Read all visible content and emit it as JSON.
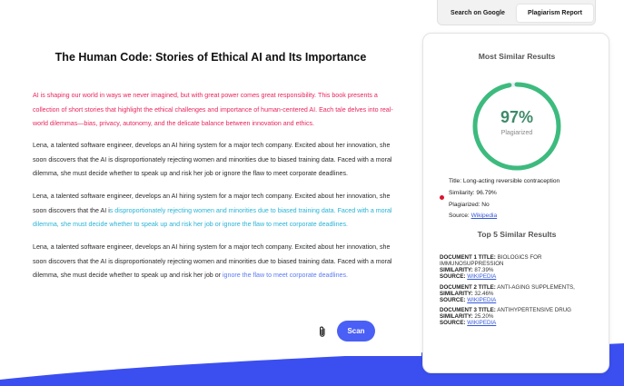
{
  "editor": {
    "title": "The Human Code: Stories of Ethical AI and Its Importance",
    "intro": "AI is shaping our world in ways we never imagined, but with great power comes great responsibility. This book presents a collection of short stories that highlight the ethical challenges and importance of human-centered AI. Each tale delves into real-world dilemmas—bias, privacy, autonomy, and the delicate balance between innovation and ethics.",
    "para1": "Lena, a talented software engineer, develops an AI hiring system for a major tech company. Excited about her innovation, she soon discovers that the AI is disproportionately rejecting women and minorities due to biased training data. Faced with a moral dilemma, she must decide whether to speak up and risk her job or ignore the flaw to meet corporate deadlines.",
    "para2_plain": "Lena, a talented software engineer, develops an AI hiring system for a major tech company. Excited about her innovation, she soon discovers that the AI i",
    "para2_highlight": "s disproportionately rejecting women and minorities due to biased training data. Faced with a moral dilemma, she must decide whether to speak up and risk her job or ignore the flaw to meet corporate deadlines.",
    "para3_plain": "Lena, a talented software engineer, develops an AI hiring system for a major tech company. Excited about her innovation, she soon discovers that the AI is disproportionately rejecting women and minorities due to biased training data. Faced with a moral dilemma, she must decide whether to speak up and risk her job or ",
    "para3_highlight": "ignore the flaw to meet corporate deadlines.",
    "scan_label": "Scan",
    "attach_icon": "paperclip-icon"
  },
  "tabs": [
    {
      "label": "Search on Google",
      "active": false
    },
    {
      "label": "Plagiarism Report",
      "active": true
    }
  ],
  "report": {
    "heading": "Most  Similar Results",
    "percent": "97%",
    "percent_value": 0.97,
    "percent_caption": "Plagiarized",
    "title_line": "Title: Long-acting reversible contraception",
    "similarity_line": "Similarity: 96.79%",
    "plagiarized_line": "Plagiarized: No",
    "source_label": "Source: ",
    "source_link": "Wikipedia",
    "top5_heading": "Top 5 Similar Results",
    "documents": [
      {
        "title_label": "DOCUMENT 1 TITLE:",
        "title": "BIOLOGICS FOR IMMUNOSUPPRESSION",
        "similarity_label": "SIMILARITY:",
        "similarity": "87.39%",
        "source_label": "SOURCE:",
        "source": "WIKIPEDIA"
      },
      {
        "title_label": "DOCUMENT 2 TITLE:",
        "title": "ANTI-AGING SUPPLEMENTS,",
        "similarity_label": "SIMILARITY:",
        "similarity": "32.46%",
        "source_label": "SOURCE:",
        "source": "WIKIPEDIA"
      },
      {
        "title_label": "DOCUMENT 3 TITLE:",
        "title": "ANTIHYPERTENSIVE DRUG",
        "similarity_label": "SIMILARITY:",
        "similarity": "25.20%",
        "source_label": "SOURCE:",
        "source": "WIKIPEDIA"
      }
    ]
  },
  "colors": {
    "accent": "#4a5ff5",
    "gauge": "#3dbb7e",
    "highlight_red": "#e8265e",
    "highlight_cyan": "#28b3d6",
    "highlight_blue": "#5b7bf4",
    "band": "#3b4ff0"
  }
}
